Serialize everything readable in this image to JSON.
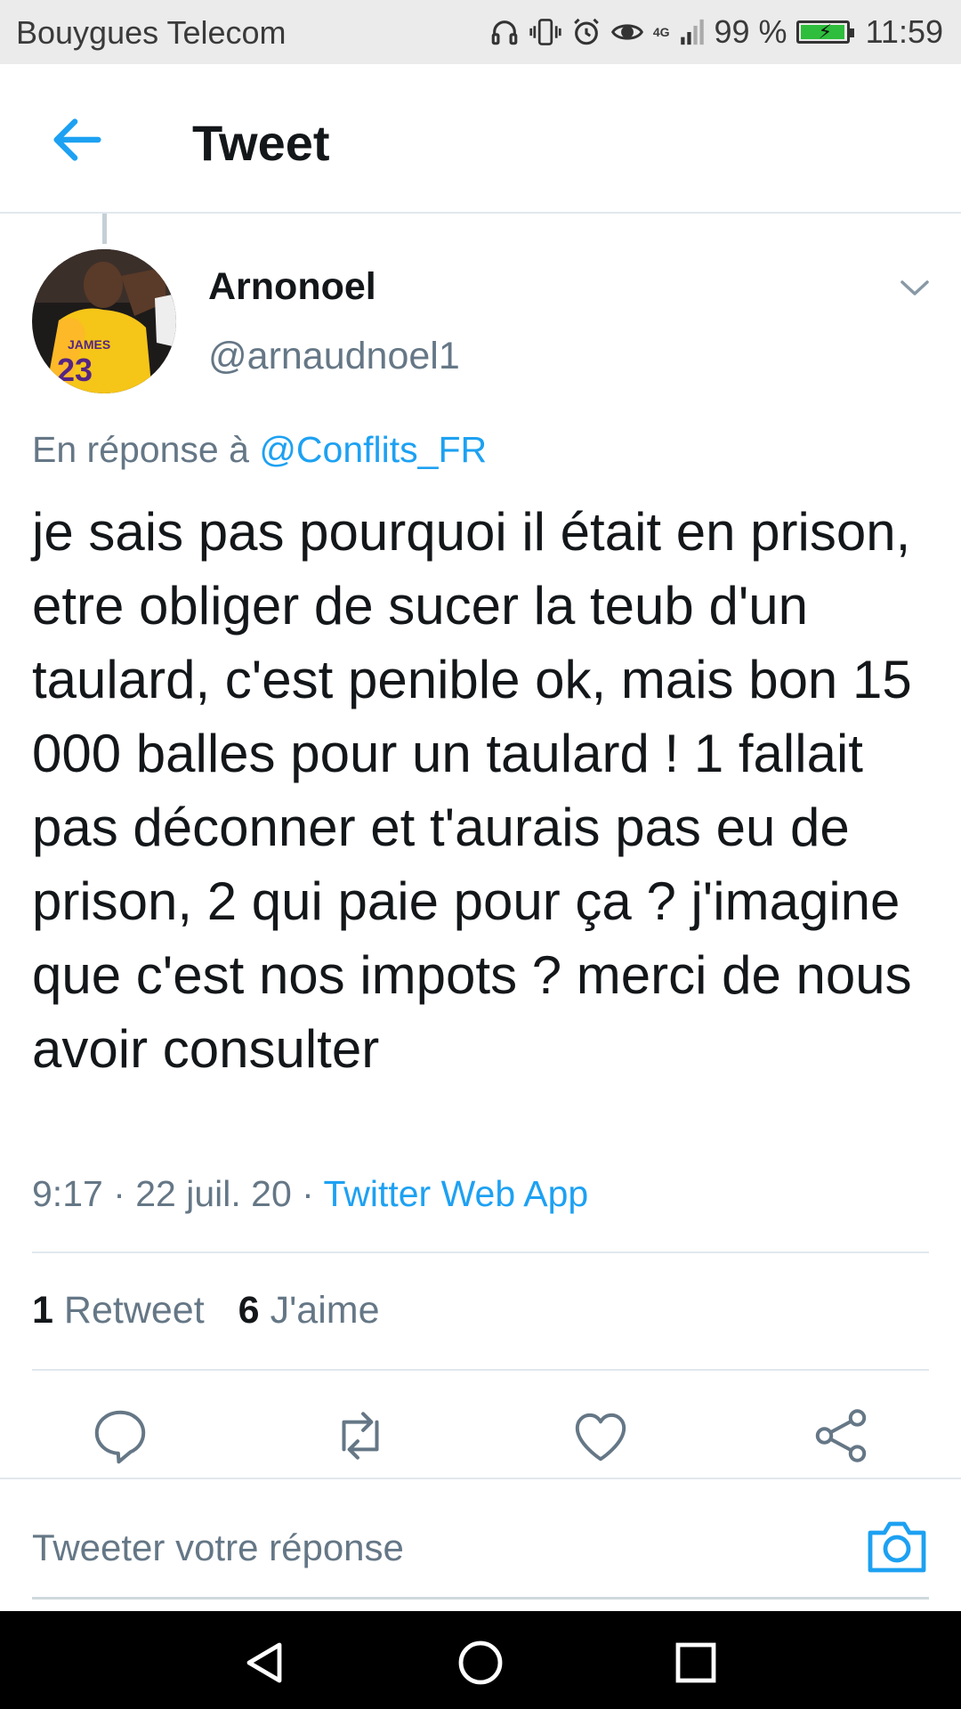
{
  "status_bar": {
    "carrier": "Bouygues Telecom",
    "network": "4G",
    "battery_percent": "99 %",
    "battery_level": 0.99,
    "time": "11:59",
    "icons": [
      "headphones-icon",
      "vibrate-icon",
      "alarm-icon",
      "eye-icon",
      "signal-icon",
      "battery-icon"
    ]
  },
  "header": {
    "title": "Tweet",
    "back_icon": "arrow-left-icon"
  },
  "tweet": {
    "author_name": "Arnonoel",
    "author_handle": "@arnaudnoel1",
    "reply_prefix": "En réponse à",
    "reply_mention": "@Conflits_FR",
    "text": "je sais pas pourquoi il était en prison, etre obliger de sucer la teub d'un taulard, c'est penible ok, mais bon 15 000 balles pour un taulard ! 1 fallait pas déconner et t'aurais pas eu de prison, 2 qui paie pour ça ? j'imagine que c'est nos impots ? merci de nous avoir consulter",
    "timestamp": "9:17 · 22 juil. 20 · ",
    "source": "Twitter Web App"
  },
  "stats": {
    "retweet_count": "1",
    "retweet_label": "Retweet",
    "like_count": "6",
    "like_label": "J'aime"
  },
  "actions": [
    "reply-icon",
    "retweet-icon",
    "like-icon",
    "share-icon"
  ],
  "compose": {
    "placeholder": "Tweeter votre réponse"
  },
  "colors": {
    "accent": "#1da1f2",
    "secondary_text": "#657786",
    "primary_text": "#14171a",
    "divider": "#e1e8ed"
  }
}
